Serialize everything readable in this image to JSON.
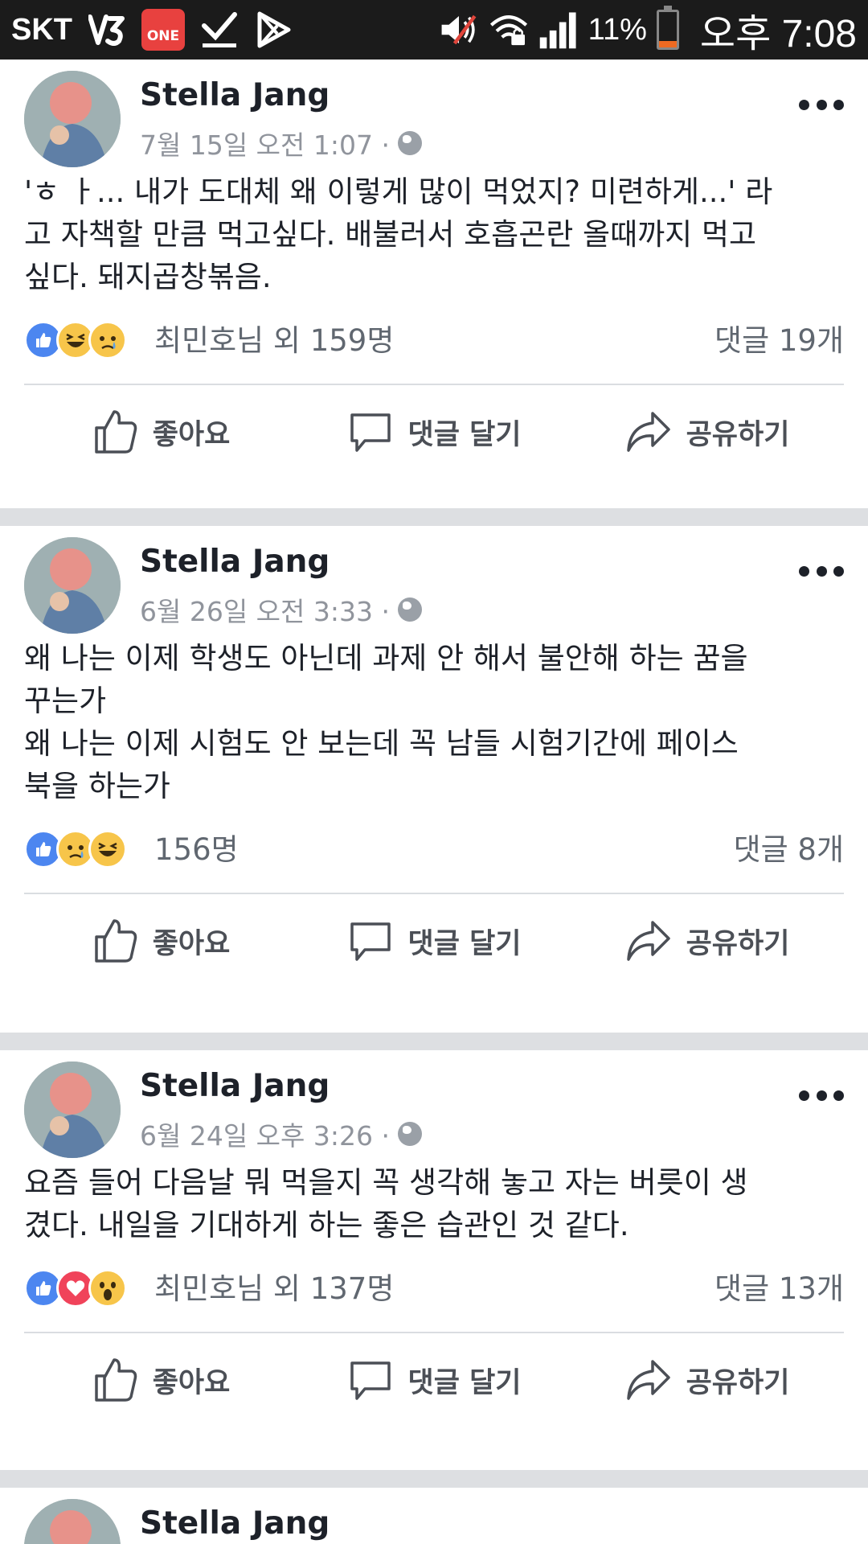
{
  "status_bar": {
    "carrier": "SKT",
    "app_icon_one": "ONE",
    "icons": [
      "v3-app-icon",
      "one-store-icon",
      "download-check-icon",
      "play-store-icon",
      "mute-icon",
      "wifi-lock-icon",
      "signal-icon"
    ],
    "battery_text": "11%",
    "time": "오후 7:08",
    "colors": {
      "background": "#1b1b1b",
      "battery_low": "#ee6a22",
      "one_badge": "#e8413f"
    }
  },
  "posts": [
    {
      "author": "Stella Jang",
      "timestamp": "7월 15일 오전 1:07 ·",
      "text": "'ㅎ ㅏ... 내가 도대체 왜 이렇게 많이 먹었지? 미련하게...' 라\n고 자책할 만큼 먹고싶다. 배불러서 호흡곤란 올때까지 먹고\n싶다. 돼지곱창볶음.",
      "reactions": [
        "like",
        "haha",
        "sad"
      ],
      "reactions_text": "최민호님 외 159명",
      "comments": "댓글 19개"
    },
    {
      "author": "Stella Jang",
      "timestamp": "6월 26일 오전 3:33 ·",
      "text": "왜 나는 이제 학생도 아닌데 과제 안 해서 불안해 하는 꿈을\n꾸는가\n왜 나는 이제 시험도 안 보는데 꼭 남들 시험기간에 페이스\n북을 하는가",
      "reactions": [
        "like",
        "sad",
        "haha"
      ],
      "reactions_text": "156명",
      "comments": "댓글 8개"
    },
    {
      "author": "Stella Jang",
      "timestamp": "6월 24일 오후 3:26 ·",
      "text": "요즘 들어 다음날 뭐 먹을지 꼭 생각해 놓고 자는 버릇이 생\n겼다. 내일을 기대하게 하는 좋은 습관인 것 같다.",
      "reactions": [
        "like",
        "love",
        "wow"
      ],
      "reactions_text": "최민호님 외 137명",
      "comments": "댓글 13개"
    },
    {
      "author": "Stella Jang"
    }
  ],
  "actions": {
    "like": "좋아요",
    "comment": "댓글 달기",
    "share": "공유하기"
  },
  "colors": {
    "like_blue": "#4c86f0",
    "love_red": "#f0435a",
    "emoji_yellow": "#f7c54a",
    "text_secondary": "#90949c",
    "feed_separator": "#dddfe2"
  }
}
